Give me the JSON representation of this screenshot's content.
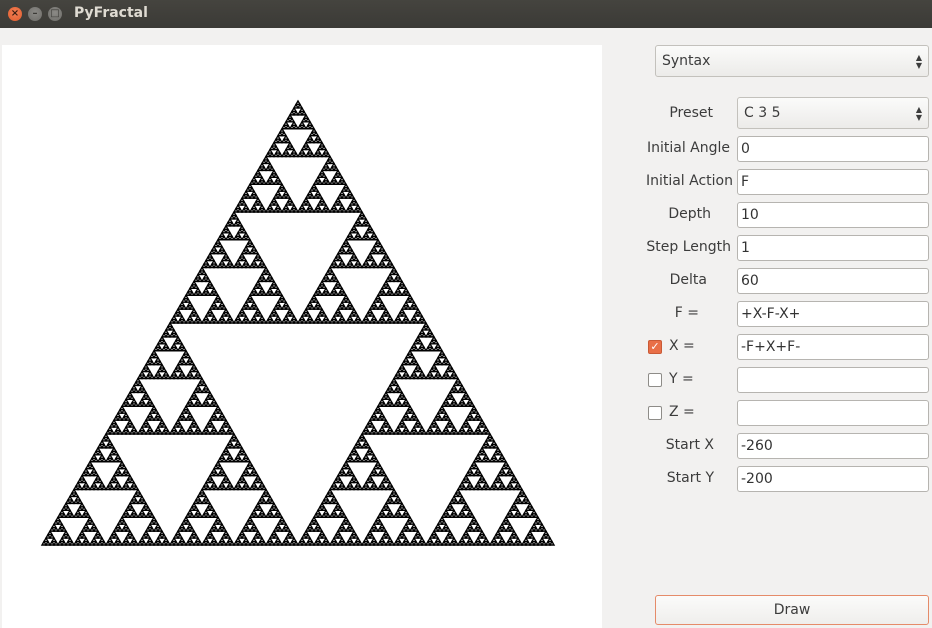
{
  "window": {
    "title": "PyFractal"
  },
  "controls": {
    "mode": "Syntax",
    "preset_label": "Preset",
    "preset_value": "C 3 5",
    "initial_angle_label": "Initial Angle",
    "initial_angle_value": "0",
    "initial_action_label": "Initial Action",
    "initial_action_value": "F",
    "depth_label": "Depth",
    "depth_value": "10",
    "step_length_label": "Step Length",
    "step_length_value": "1",
    "delta_label": "Delta",
    "delta_value": "60",
    "f_label": "F =",
    "f_value": "+X-F-X+",
    "x_label": "X =",
    "x_value": "-F+X+F-",
    "x_checked": true,
    "y_label": "Y =",
    "y_value": "",
    "y_checked": false,
    "z_label": "Z =",
    "z_value": "",
    "z_checked": false,
    "start_x_label": "Start X",
    "start_x_value": "-260",
    "start_y_label": "Start Y",
    "start_y_value": "-200",
    "draw_label": "Draw"
  },
  "icons": {
    "close": "close-icon",
    "minimize": "minimize-icon",
    "maximize": "maximize-icon",
    "combo_arrows": "up-down-arrows-icon",
    "checkmark": "checkmark-icon"
  },
  "colors": {
    "accent": "#e96f47",
    "titlebar": "#3b3a36",
    "panel": "#f2f1f0",
    "fractal": "#000000"
  }
}
